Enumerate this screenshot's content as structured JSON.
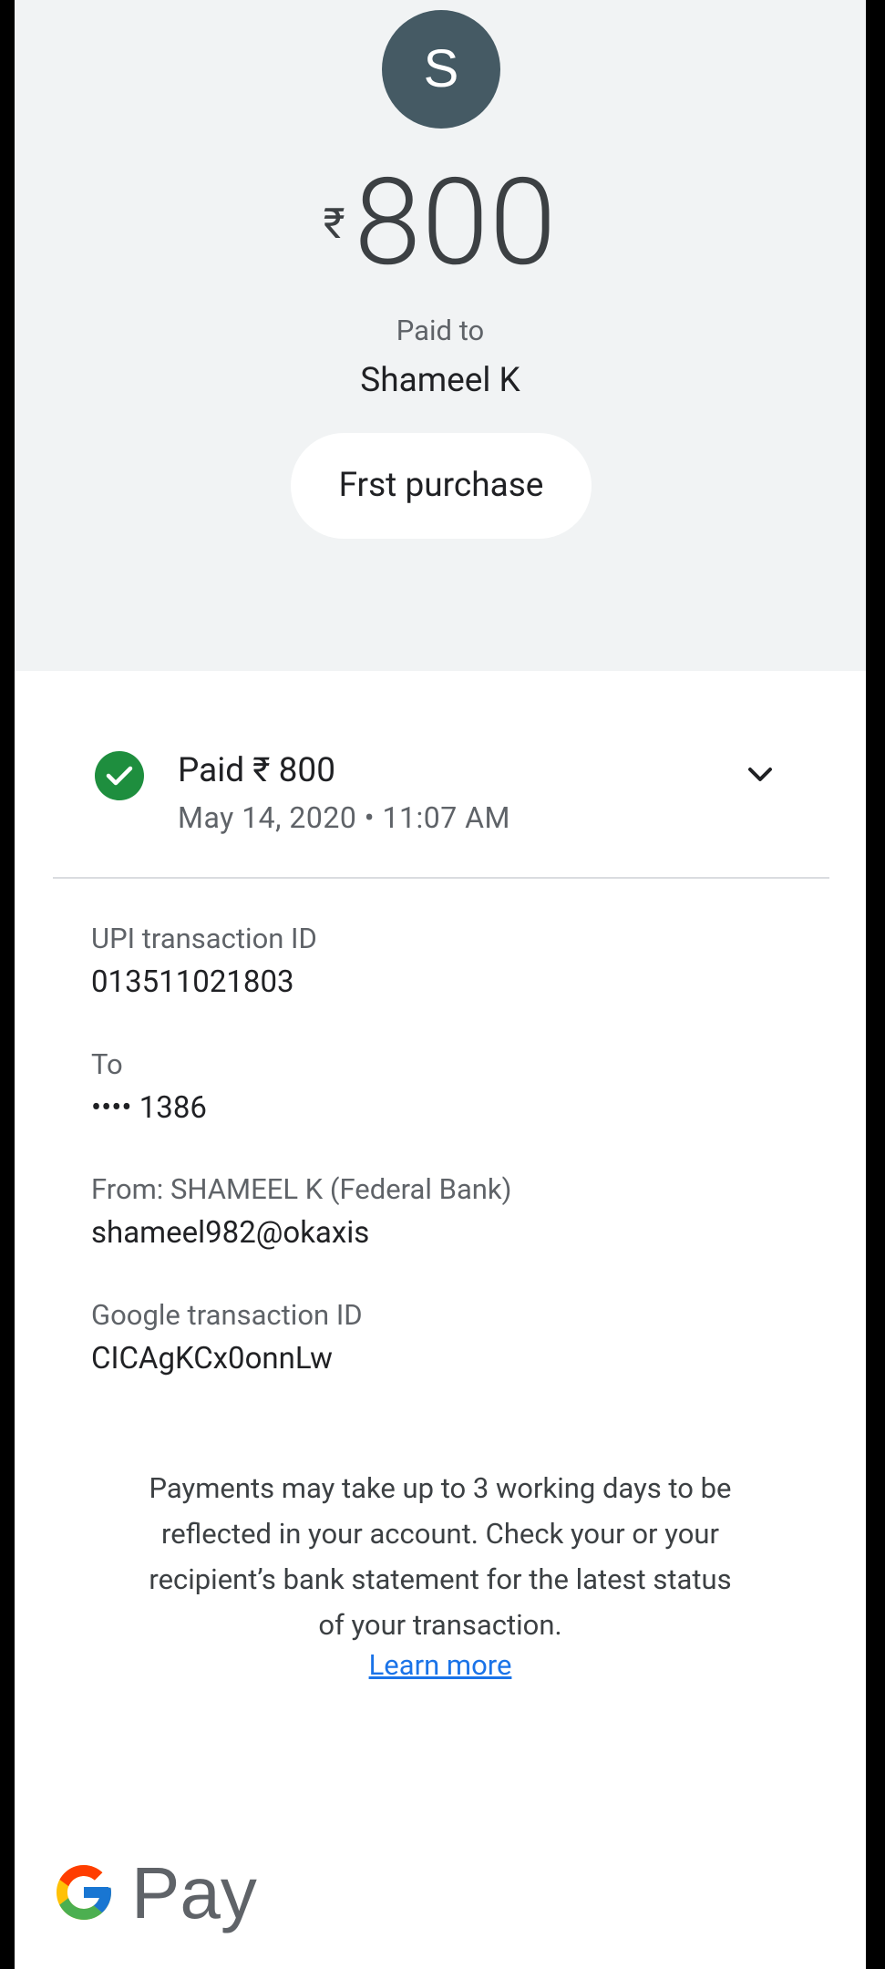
{
  "header": {
    "avatar_initial": "S",
    "currency_symbol": "₹",
    "amount": "800",
    "paid_to_label": "Paid to",
    "payee_name": "Shameel K",
    "note": "Frst purchase"
  },
  "status": {
    "title": "Paid ₹ 800",
    "datetime": "May 14, 2020 • 11:07 AM",
    "icon": "check-circle-icon",
    "expand_icon": "chevron-down-icon"
  },
  "details": {
    "upi_label": "UPI transaction ID",
    "upi_value": "013511021803",
    "to_label": "To",
    "to_value": "•••• 1386",
    "from_label": "From: SHAMEEL K (Federal Bank)",
    "from_value": "shameel982@okaxis",
    "google_label": "Google transaction ID",
    "google_value": "CICAgKCx0onnLw"
  },
  "disclaimer": {
    "text": "Payments may take up to 3 working days to be reflected in your account. Check your or your recipient’s bank statement for the latest status of your transaction.",
    "learn_more": "Learn more"
  },
  "brand": {
    "name": "Pay",
    "logo_icon": "google-g-logo"
  },
  "colors": {
    "header_bg": "#f1f3f4",
    "avatar_bg": "#455a64",
    "success": "#1e8e3e",
    "link": "#1a73e8"
  }
}
